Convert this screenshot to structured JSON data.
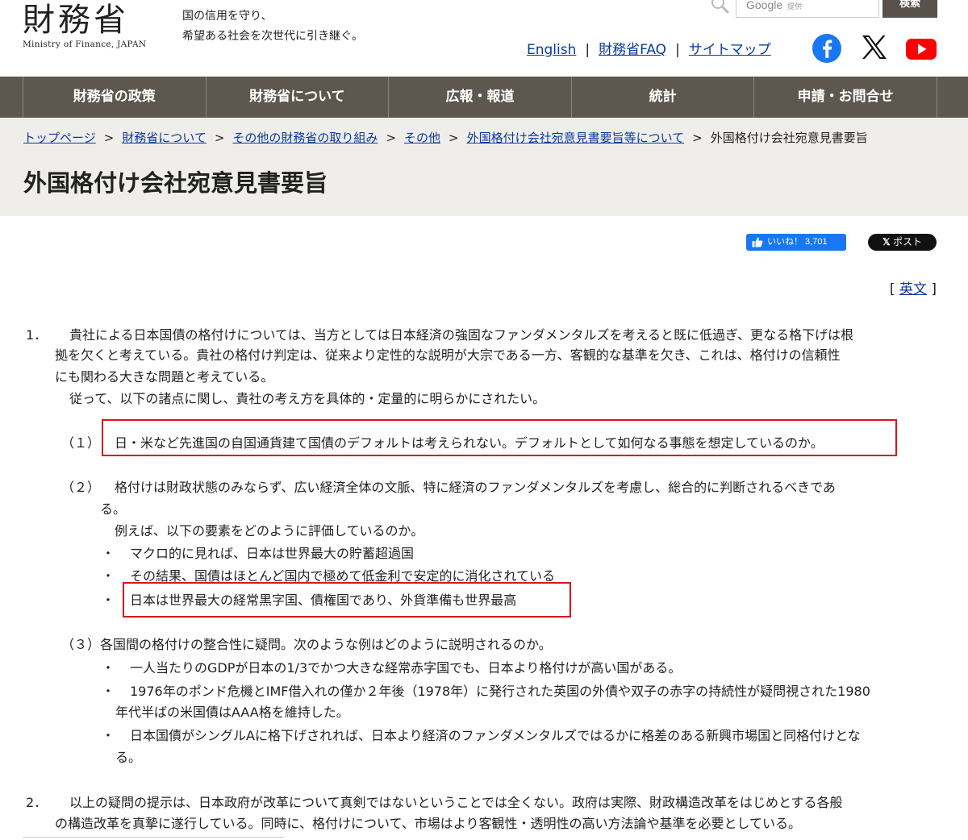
{
  "header": {
    "logo_jp": "財務省",
    "logo_en": "Ministry of Finance, JAPAN",
    "tagline_line1": "国の信用を守り、",
    "tagline_line2": "希望ある社会を次世代に引き継ぐ。",
    "search": {
      "brand": "Google",
      "brand_sub": "提供",
      "button": "検索"
    },
    "links": [
      "English",
      "財務省FAQ",
      "サイトマップ"
    ],
    "social": [
      "facebook-icon",
      "x-icon",
      "youtube-icon"
    ]
  },
  "nav": {
    "items": [
      "財務省の政策",
      "財務省について",
      "広報・報道",
      "統計",
      "申請・お問合せ"
    ]
  },
  "breadcrumb": {
    "links": [
      "トップページ",
      "財務省について",
      "その他の財務省の取り組み",
      "その他",
      "外国格付け会社宛意見書要旨等について"
    ],
    "current": "外国格付け会社宛意見書要旨",
    "sep": ">"
  },
  "page": {
    "title": "外国格付け会社宛意見書要旨",
    "like_label": "いいね！ 3,701",
    "post_label": "ポスト",
    "english_link_open": "[",
    "english_link_text": "英文",
    "english_link_close": "]"
  },
  "content": {
    "p1_num": "1．",
    "p1_l1": "貴社による日本国債の格付けについては、当方としては日本経済の強固なファンダメンタルズを考えると既に低過ぎ、更なる格下げは根",
    "p1_l2": "拠を欠くと考えている。貴社の格付け判定は、従来より定性的な説明が大宗である一方、客観的な基準を欠き、これは、格付けの信頼性",
    "p1_l3": "にも関わる大きな問題と考えている。",
    "p1_l4": "従って、以下の諸点に関し、貴社の考え方を具体的・定量的に明らかにされたい。",
    "s1_num": "（１）",
    "s1_text": "日・米など先進国の自国通貨建て国債のデフォルトは考えられない。デフォルトとして如何なる事態を想定しているのか。",
    "s2_num": "（２）",
    "s2_l1": "格付けは財政状態のみならず、広い経済全体の文脈、特に経済のファンダメンタルズを考慮し、総合的に判断されるべきであ",
    "s2_l2": "る。",
    "s2_l3": "例えば、以下の要素をどのように評価しているのか。",
    "bullet": "・",
    "s2_b1": "マクロ的に見れば、日本は世界最大の貯蓄超過国",
    "s2_b2": "その結果、国債はほとんど国内で極めて低金利で安定的に消化されている",
    "s2_b3": "日本は世界最大の経常黒字国、債権国であり、外貨準備も世界最高",
    "s3_num": "（３）",
    "s3_text": "各国間の格付けの整合性に疑問。次のような例はどのように説明されるのか。",
    "s3_b1": "一人当たりのGDPが日本の1/3でかつ大きな経常赤字国でも、日本より格付けが高い国がある。",
    "s3_b2_l1": "1976年のポンド危機とIMF借入れの僅か２年後（1978年）に発行された英国の外債や双子の赤字の持続性が疑問視された1980",
    "s3_b2_l2": "年代半ばの米国債はAAA格を維持した。",
    "s3_b3_l1": "日本国債がシングルAに格下げされれば、日本より経済のファンダメンタルズではるかに格差のある新興市場国と同格付けとな",
    "s3_b3_l2": "る。",
    "p2_num": "2．",
    "p2_l1": "以上の疑問の提示は、日本政府が改革について真剣ではないということでは全くない。政府は実際、財政構造改革をはじめとする各般",
    "p2_l2": "の構造改革を真摯に遂行している。同時に、格付けについて、市場はより客観性・透明性の高い方法論や基準を必要としている。"
  },
  "colors": {
    "nav_bg": "#5d574f",
    "title_band_bg": "#efeeeb",
    "link": "#0b3a9e",
    "highlight_box": "#d9141b",
    "facebook": "#1877f2",
    "youtube": "#ff0000"
  }
}
